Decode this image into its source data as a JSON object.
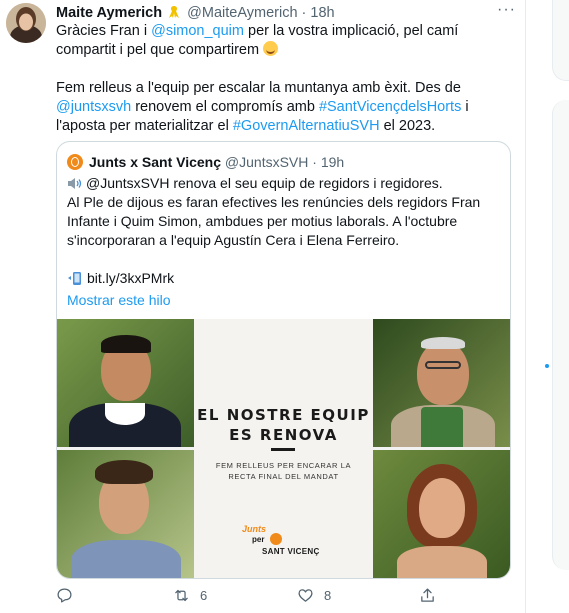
{
  "tweet": {
    "author_name": "Maite Aymerich",
    "author_handle": "@MaiteAymerich",
    "separator": "·",
    "time": "18h",
    "more_label": "···",
    "text": {
      "line1_pre": "Gràcies Fran i ",
      "mention1": "@simon_quim",
      "line1_post": " per la vostra implicació, pel camí compartit i pel que compartirem ",
      "p2_pre": "Fem relleus a l'equip per escalar la muntanya amb èxit. Des de ",
      "mention2": "@juntsxsvh",
      "p2_mid1": " renovem el compromís amb ",
      "hashtag1": "#SantVicençdelsHorts",
      "p2_mid2": " i l'aposta per materialitzar el ",
      "hashtag2": "#GovernAlternatiuSVH",
      "p2_post": " el 2023."
    },
    "quote": {
      "author_name": "Junts x Sant Vicenç",
      "author_handle": "@JuntsxSVH",
      "separator": "·",
      "time": "19h",
      "line1": "@JuntsxSVH renova el seu equip de regidors i regidores.",
      "line2": "Al Ple de dijous es faran efectives les renúncies dels regidors Fran Infante i Quim Simon, ambdues per motius laborals. A l'octubre s'incorporaran a l'equip Agustín Cera i Elena Ferreiro.",
      "link": "bit.ly/3kxPMrk",
      "show_thread": "Mostrar este hilo",
      "image": {
        "title": "EL NOSTRE EQUIP ES RENOVA",
        "subtitle": "FEM RELLEUS PER ENCARAR LA RECTA FINAL DEL MANDAT",
        "logo_junts": "Junts",
        "logo_per": "per",
        "logo_place": "SANT VICENÇ"
      }
    },
    "actions": {
      "reply_count": "",
      "retweet_count": "6",
      "like_count": "8"
    }
  },
  "colors": {
    "link": "#1d9bf0",
    "muted": "#536471",
    "brand_orange": "#f08a1a",
    "border": "#cfd9de"
  },
  "icons": [
    "reply-icon",
    "retweet-icon",
    "like-icon",
    "share-icon",
    "speaker-icon",
    "phone-icon",
    "more-icon"
  ]
}
